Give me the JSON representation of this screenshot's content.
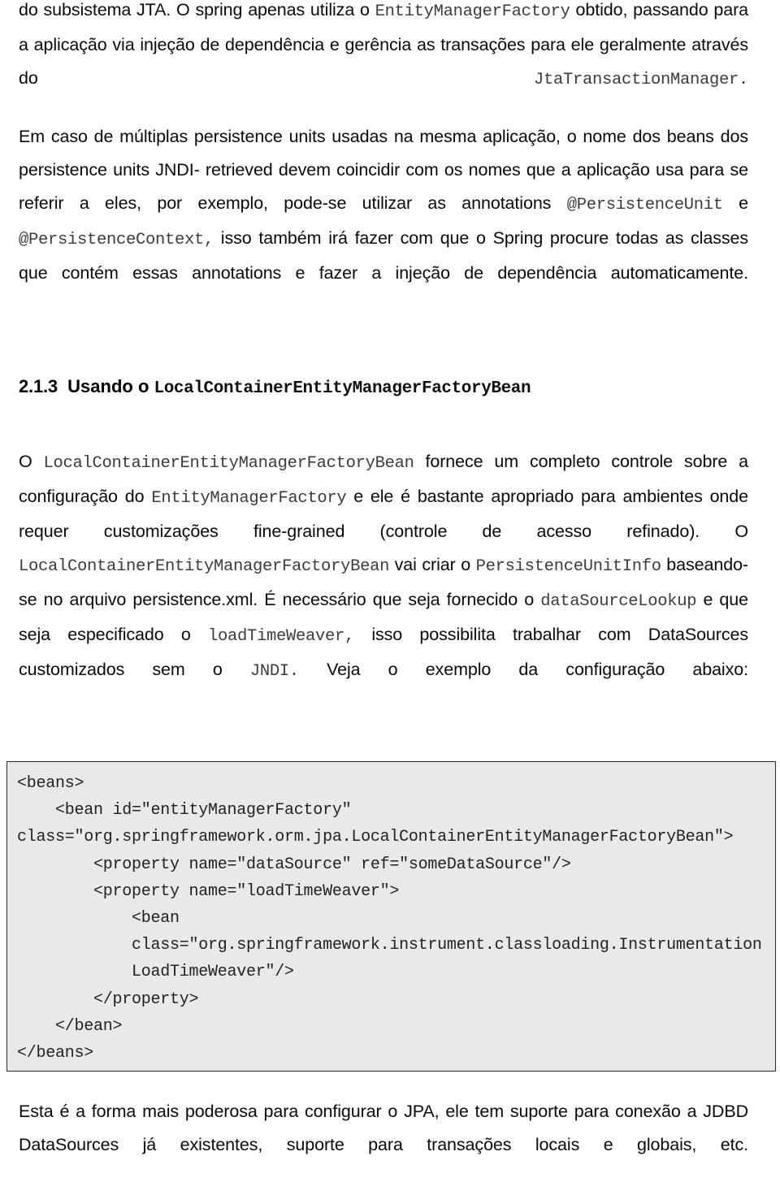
{
  "document": {
    "language": "pt-BR",
    "page_background": "#ffffff",
    "text_color": "#0a0a0a",
    "code_text_color": "#3c3c3c",
    "code_block_background": "#e9e9e9",
    "code_block_border_color": "#2a2a2a"
  },
  "paragraphs": {
    "p1": {
      "s1": "do subsistema JTA. O spring apenas utiliza o ",
      "c1": "EntityManagerFactory",
      "s2": " obtido, passando para a aplicação via injeção de dependência e gerência as transações para ele geralmente através do ",
      "c2": "JtaTransactionManager."
    },
    "p2": {
      "s1": "Em caso de múltiplas persistence units usadas na mesma aplicação, o nome dos beans dos persistence units JNDI- retrieved devem coincidir com os nomes que a aplicação usa para se referir a eles, por exemplo, pode-se utilizar as annotations ",
      "c1": "@PersistenceUnit",
      "s2": " e ",
      "c2": "@PersistenceContext,",
      "s3": " isso também irá fazer com que o Spring procure todas as classes que contém essas annotations e fazer a injeção de dependência automaticamente."
    },
    "p3": {
      "s1": "O ",
      "c1": "LocalContainerEntityManagerFactoryBean",
      "s2": " fornece um completo controle sobre a configuração do ",
      "c2": "EntityManagerFactory",
      "s3": " e ele é bastante apropriado para ambientes onde requer customizações fine-grained (controle de acesso refinado). O ",
      "c3": "LocalContainerEntityManagerFactoryBean",
      "s4": " vai criar o ",
      "c4": "PersistenceUnitInfo",
      "s5": " baseando-se no arquivo persistence.xml. É necessário que seja fornecido o ",
      "c5": "dataSourceLookup",
      "s6": " e que seja especificado o ",
      "c6": "loadTimeWeaver,",
      "s7": " isso possibilita trabalhar com DataSources customizados sem o ",
      "c7": "JNDI.",
      "s8": " Veja o exemplo da configuração abaixo:"
    },
    "p4": {
      "line1": "Esta é a forma mais poderosa para configurar o JPA, ele tem suporte para conexão a",
      "line2": "JDBD DataSources já existentes, suporte para transações locais e globais, etc."
    }
  },
  "heading": {
    "number": "2.1.3",
    "text": "Usando o",
    "mono": "LocalContainerEntityManagerFactoryBean"
  },
  "code_block": {
    "language": "xml",
    "lines": [
      "<beans>",
      "    <bean id=\"entityManagerFactory\"",
      "class=\"org.springframework.orm.jpa.LocalContainerEntityManagerFactoryBean\">",
      "        <property name=\"dataSource\" ref=\"someDataSource\"/>",
      "        <property name=\"loadTimeWeaver\">",
      "            <bean",
      "            class=\"org.springframework.instrument.classloading.Instrumentation",
      "            LoadTimeWeaver\"/>",
      "        </property>",
      "    </bean>",
      "</beans>"
    ],
    "text": "<beans>\n    <bean id=\"entityManagerFactory\"\nclass=\"org.springframework.orm.jpa.LocalContainerEntityManagerFactoryBean\">\n        <property name=\"dataSource\" ref=\"someDataSource\"/>\n        <property name=\"loadTimeWeaver\">\n            <bean\n            class=\"org.springframework.instrument.classloading.Instrumentation\n            LoadTimeWeaver\"/>\n        </property>\n    </bean>\n</beans>"
  }
}
